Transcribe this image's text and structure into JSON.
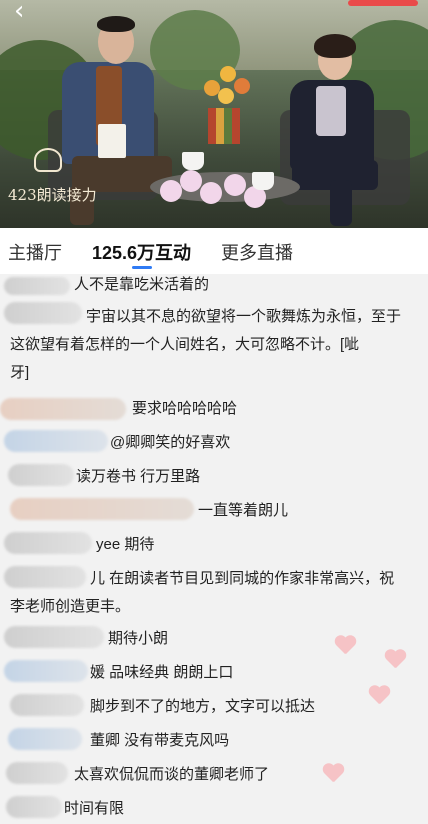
{
  "video": {
    "logo_text": "423朗读接力",
    "icon_back": "back-arrow-icon"
  },
  "tabs": [
    {
      "label": "主播厅"
    },
    {
      "label": "125.6万互动"
    },
    {
      "label": "更多直播"
    }
  ],
  "active_tab": 1,
  "comments": [
    {
      "text": "人不是靠吃米活着的"
    },
    {
      "line1": "宇宙以其不息的欲望将一个歌舞炼为永恒，至于",
      "line2": "这欲望有着怎样的一个人间姓名，大可忽略不计。[呲",
      "line3": "牙]"
    },
    {
      "text": "要求哈哈哈哈哈"
    },
    {
      "text": "@卿卿笑的好喜欢"
    },
    {
      "text": "读万卷书 行万里路"
    },
    {
      "text": "一直等着朗儿"
    },
    {
      "text": "yee 期待"
    },
    {
      "text": "儿 在朗读者节目见到同城的作家非常高兴，祝",
      "line2": "李老师创造更丰。"
    },
    {
      "text": "期待小朗"
    },
    {
      "text": "媛 品味经典 朗朗上口"
    },
    {
      "text": "脚步到不了的地方，文字可以抵达"
    },
    {
      "text": "董卿 没有带麦克风吗"
    },
    {
      "text": "太喜欢侃侃而谈的董卿老师了"
    },
    {
      "text": "时间有限"
    }
  ],
  "colors": {
    "accent": "#2f7bf5",
    "heart": "#f6c3c6",
    "comment_bg": "#f2f2f2"
  }
}
